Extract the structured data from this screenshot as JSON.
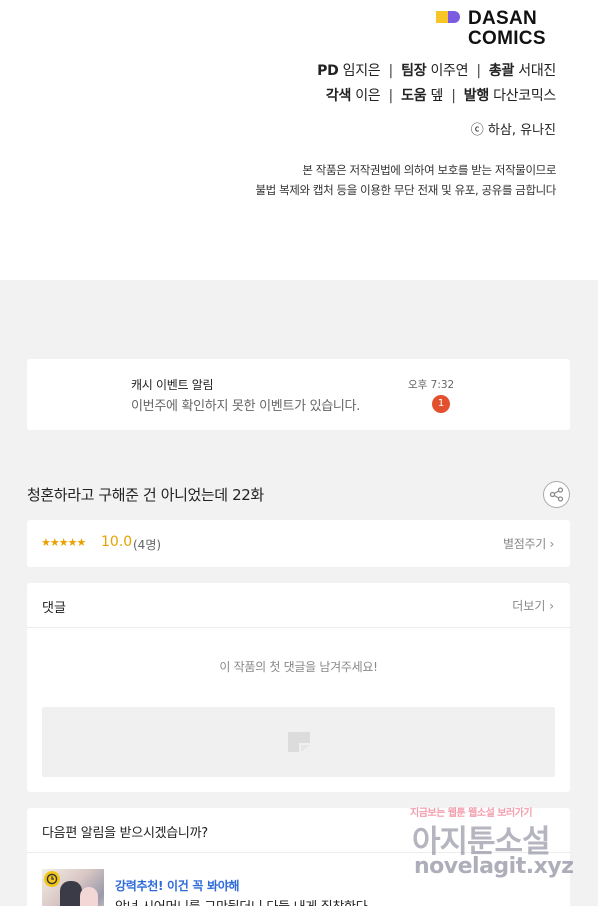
{
  "credits": {
    "logo_line1": "DASAN",
    "logo_line2": "COMICS",
    "line1": [
      {
        "role": "PD",
        "name": "임지은"
      },
      {
        "role": "팀장",
        "name": "이주연"
      },
      {
        "role": "총괄",
        "name": "서대진"
      }
    ],
    "line2": [
      {
        "role": "각색",
        "name": "이은"
      },
      {
        "role": "도움",
        "name": "뎊"
      },
      {
        "role": "발행",
        "name": "다산코믹스"
      }
    ],
    "separator": "|",
    "copyright": "ⓒ 하삼, 유나진",
    "notice_line1": "본 작품은 저작권법에 의하여 보호를 받는 저작물이므로",
    "notice_line2": "불법 복제와 캡처 등을 이용한 무단 전재 및 유포, 공유를 금합니다"
  },
  "event": {
    "title": "캐시 이벤트 알림",
    "body": "이번주에 확인하지 못한 이벤트가 있습니다.",
    "time": "오후 7:32",
    "badge_count": "1"
  },
  "episode": {
    "title": "청혼하라고 구해준 건 아니었는데 22화",
    "share_icon": "share-icon"
  },
  "rating": {
    "stars": "★★★★★",
    "score": "10.0",
    "count": "(4명)",
    "rate_link": "별점주기 ›"
  },
  "comments": {
    "title": "댓글",
    "more": "더보기 ›",
    "empty_message": "이 작품의 첫 댓글을 남겨주세요!"
  },
  "next": {
    "title": "다음편 알림을 받으시겠습니까?",
    "rec_tag": "강력추천! 이건 꼭 봐야해",
    "rec_desc": "악녀 시어머니를 그만뒀더니 다들 내게 집착한다"
  },
  "watermark": {
    "top": "지금보는 웹툰 웹소설 보러가기",
    "main": "아지툰소설",
    "url": "novelagit.xyz"
  },
  "colors": {
    "accent_star": "#e8a100",
    "badge_red": "#e2502e",
    "link_blue": "#2f6ad9",
    "logo_yellow": "#f7c626",
    "logo_purple": "#7b5ce0"
  }
}
